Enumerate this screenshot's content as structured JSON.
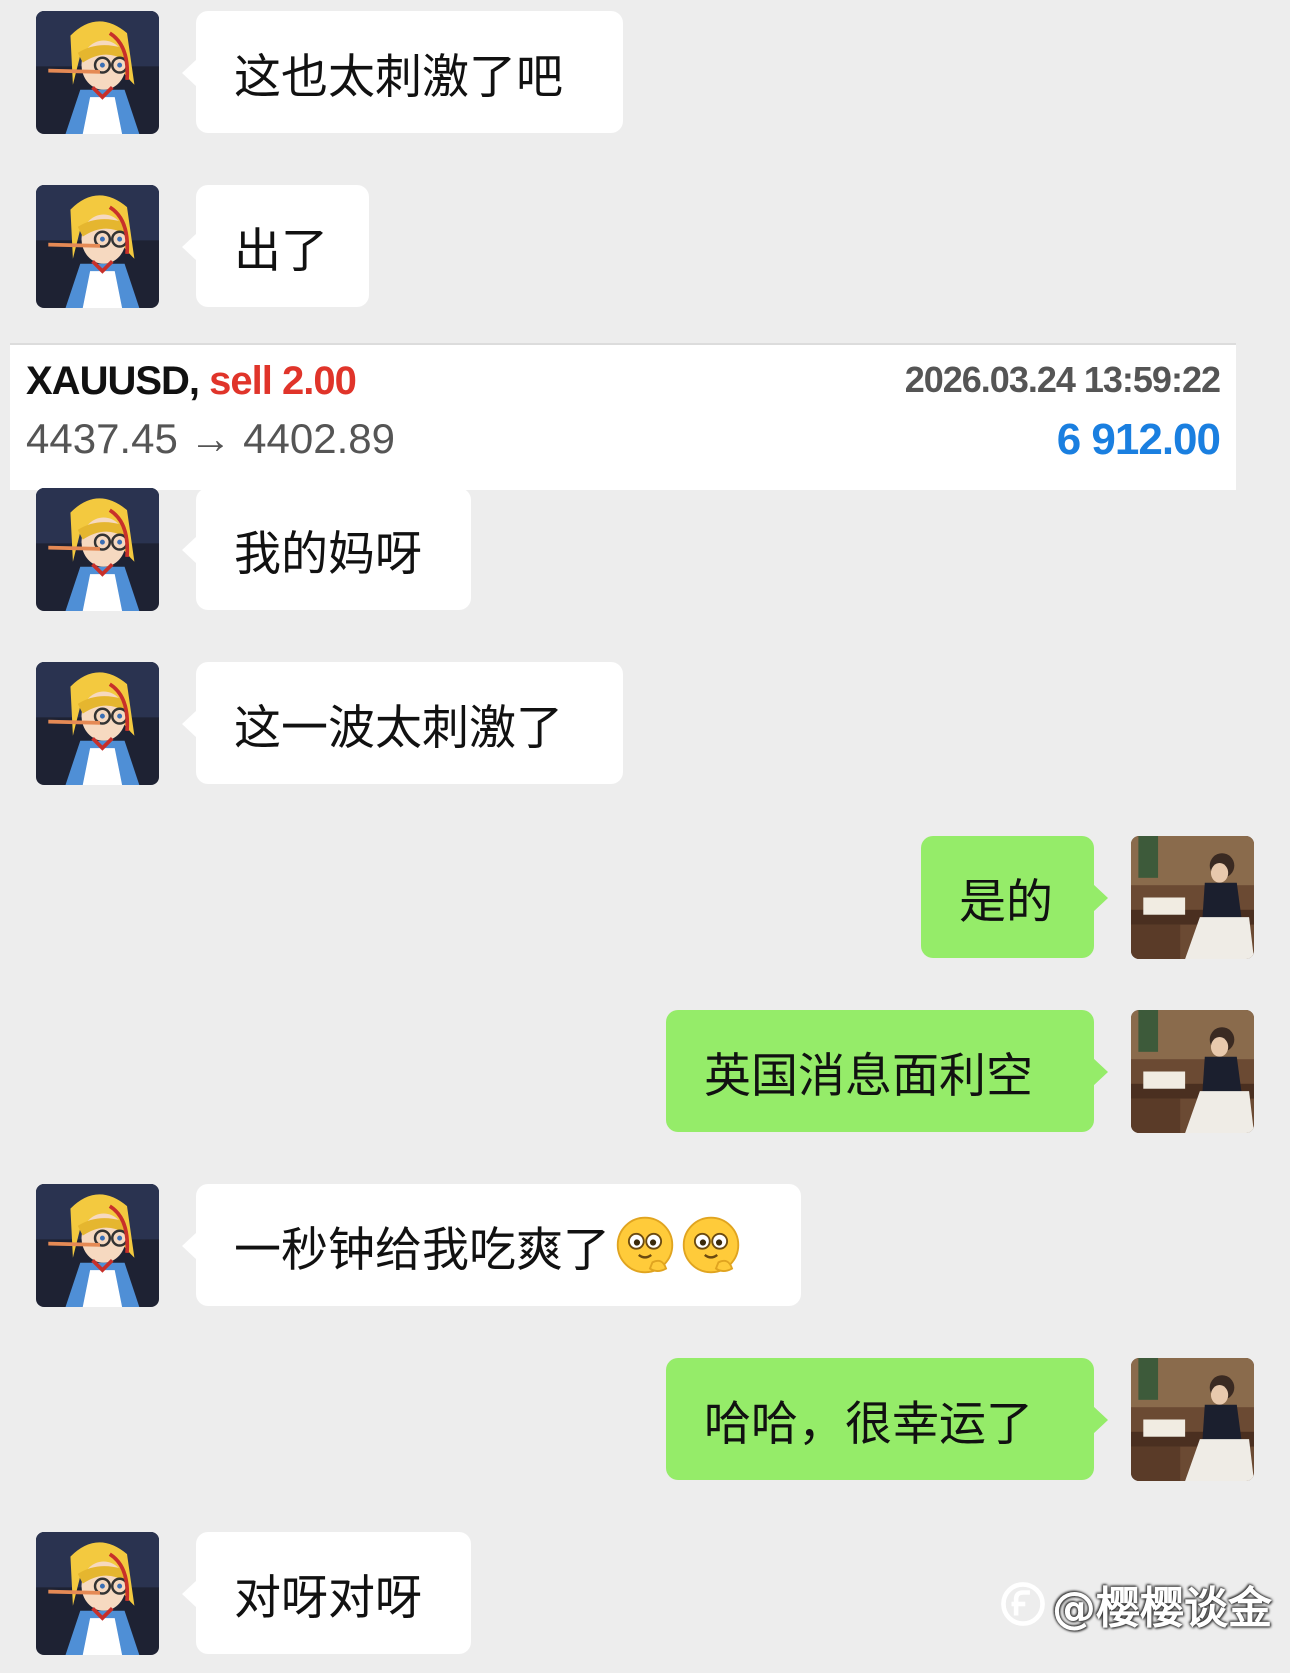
{
  "messages": [
    {
      "side": "left",
      "text": "这也太刺激了吧"
    },
    {
      "side": "left",
      "text": "出了"
    },
    {
      "side": "left",
      "text": "我的妈呀"
    },
    {
      "side": "left",
      "text": "这一波太刺激了"
    },
    {
      "side": "right",
      "text": "是的"
    },
    {
      "side": "right",
      "text": "英国消息面利空"
    },
    {
      "side": "left",
      "text": "一秒钟给我吃爽了"
    },
    {
      "side": "right",
      "text": "哈哈，很幸运了"
    },
    {
      "side": "left",
      "text": "对呀对呀"
    }
  ],
  "trade": {
    "symbol": "XAUUSD,",
    "side": "sell 2.00",
    "prices": "4437.45 → 4402.89",
    "time": "2026.03.24 13:59:22",
    "profit": "6 912.00"
  },
  "watermark": "@樱樱谈金",
  "icons": {
    "left_avatar": "cartoon-girl-avatar",
    "right_avatar": "reading-woman-photo-avatar",
    "emoji": "grinning-face-emoji"
  },
  "colors": {
    "background": "#ededed",
    "left_bubble": "#ffffff",
    "right_bubble": "#95ec69",
    "sell": "#e0342a",
    "profit": "#1a7fe0"
  }
}
